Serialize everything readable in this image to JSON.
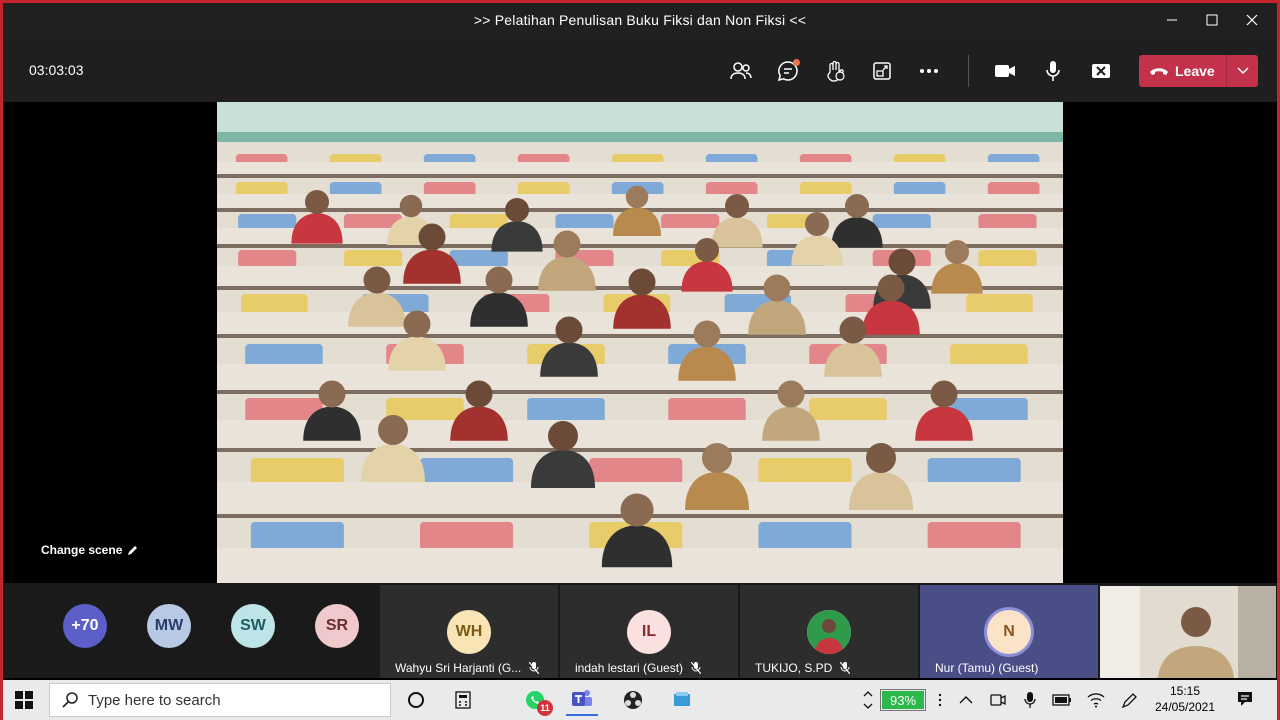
{
  "window": {
    "title": ">> Pelatihan Penulisan Buku Fiksi dan Non Fiksi <<"
  },
  "toolbar": {
    "timer": "03:03:03",
    "icons": [
      "people-icon",
      "chat-icon",
      "raise-hand-icon",
      "share-tray-icon",
      "more-icon",
      "camera-icon",
      "microphone-icon",
      "share-screen-icon"
    ],
    "leave_label": "Leave",
    "accent": "#c4314b"
  },
  "stage": {
    "change_scene_label": "Change scene"
  },
  "participants": {
    "overflow_count": "+70",
    "small_avatars": [
      {
        "initials": "MW",
        "color": "#b8c9e6"
      },
      {
        "initials": "SW",
        "color": "#bde4e6"
      },
      {
        "initials": "SR",
        "color": "#f0c9cc"
      }
    ],
    "tiles": [
      {
        "initials": "WH",
        "name": "Wahyu Sri Harjanti (G...",
        "color": "#f8e4b4"
      },
      {
        "initials": "IL",
        "name": "indah lestari (Guest)",
        "color": "#fbe0e0"
      },
      {
        "initials": "",
        "name": "TUKIJO, S.PD",
        "color": "#ffffff"
      },
      {
        "initials": "N",
        "name": "Nur (Tamu) (Guest)",
        "color": "#fbe3c8"
      }
    ]
  },
  "taskbar": {
    "search_placeholder": "Type here to search",
    "whatsapp_badge": "11",
    "battery_percent": "93%",
    "time": "15:15",
    "date": "24/05/2021"
  }
}
